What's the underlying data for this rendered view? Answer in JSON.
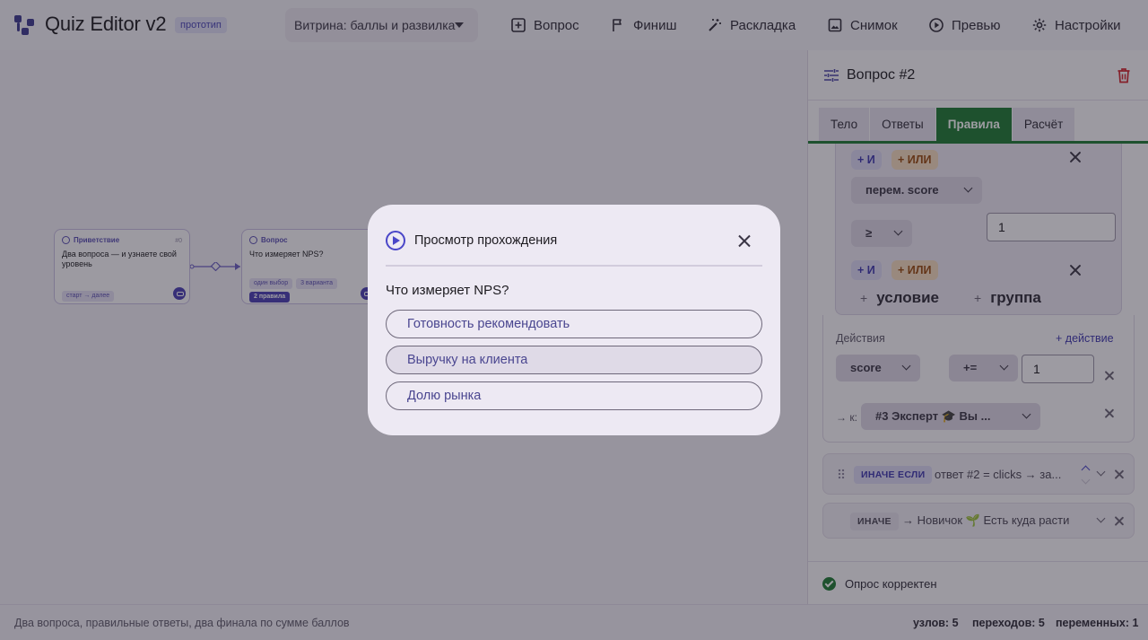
{
  "app": {
    "title": "Quiz Editor v2",
    "badge": "прототип"
  },
  "toolbar": {
    "preset": "Витрина: баллы и развилка",
    "buttons": [
      "Вопрос",
      "Финиш",
      "Раскладка",
      "Снимок",
      "Превью",
      "Настройки"
    ]
  },
  "canvas": {
    "nodes": [
      {
        "type": "Приветствие",
        "id": "#0",
        "text": "Два вопроса — и узнаете свой уровень",
        "tags": [
          "старт → далее"
        ]
      },
      {
        "type": "Вопрос",
        "text": "Что измеряет NPS?",
        "tags": [
          "один выбор",
          "3 варианта"
        ],
        "strong_tag": "2 правила"
      }
    ]
  },
  "panel": {
    "title": "Вопрос #2",
    "tabs": [
      "Тело",
      "Ответы",
      "Правила",
      "Расчёт"
    ],
    "active_tab": "Правила",
    "conditions": {
      "and_label": "+ И",
      "or_label": "+ ИЛИ",
      "var_select": "перем. score",
      "op_select": "≥",
      "value": "1",
      "add_condition": "условие",
      "add_group": "группа"
    },
    "actions": {
      "label": "Действия",
      "add_action": "+ действие",
      "var": "score",
      "op": "+=",
      "value": "1",
      "goto_label": "→ к:",
      "goto_target": "#3 Эксперт 🎓 Вы ..."
    },
    "rules": [
      {
        "badge": "ИНАЧЕ ЕСЛИ",
        "text": "ответ #2 = clicks  →  за..."
      },
      {
        "badge": "ИНАЧЕ",
        "text": "→ Новичок 🌱 Есть куда расти"
      }
    ],
    "status": "Опрос корректен"
  },
  "statusbar": {
    "description": "Два вопроса, правильные ответы, два финала по сумме баллов",
    "stats": [
      "узлов: 5",
      "переходов: 5",
      "переменных: 1"
    ]
  },
  "modal": {
    "title": "Просмотр прохождения",
    "question": "Что измеряет NPS?",
    "options": [
      "Готовность рекомендовать",
      "Выручку на клиента",
      "Долю рынка"
    ]
  },
  "colors": {
    "accent": "#4a46c8",
    "tab_active": "#1e7a34",
    "scrim": "rgba(30,27,40,0.43)"
  }
}
